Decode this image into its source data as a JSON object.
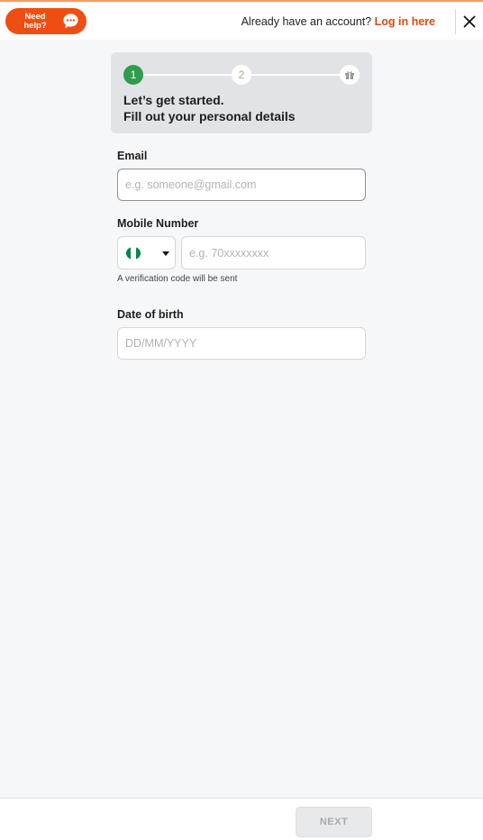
{
  "header": {
    "help_label_line1": "Need",
    "help_label_line2": "help?",
    "login_prompt": "Already have an account?",
    "login_link": "Log in here",
    "help_icon": "chat-bubble-icon",
    "close_icon": "close-icon"
  },
  "stepper": {
    "steps": [
      {
        "label": "1",
        "state": "active"
      },
      {
        "label": "2",
        "state": "pending"
      },
      {
        "label": "",
        "icon": "gift-icon",
        "state": "pending"
      }
    ],
    "title": "Let’s get started.",
    "subtitle": "Fill out your personal details"
  },
  "form": {
    "email": {
      "label": "Email",
      "placeholder": "e.g. someone@gmail.com",
      "value": ""
    },
    "mobile": {
      "label": "Mobile Number",
      "placeholder": "e.g. 70xxxxxxxx",
      "value": "",
      "country_flag": "nigeria-flag-icon",
      "hint": "A verification code will be sent"
    },
    "dob": {
      "label": "Date of birth",
      "placeholder": "DD/MM/YYYY",
      "value": ""
    }
  },
  "footer": {
    "next_label": "NEXT"
  },
  "colors": {
    "accent": "#ef4e12",
    "link": "#e2470f",
    "step_active": "#2f9c4f",
    "flag_green": "#008751"
  }
}
